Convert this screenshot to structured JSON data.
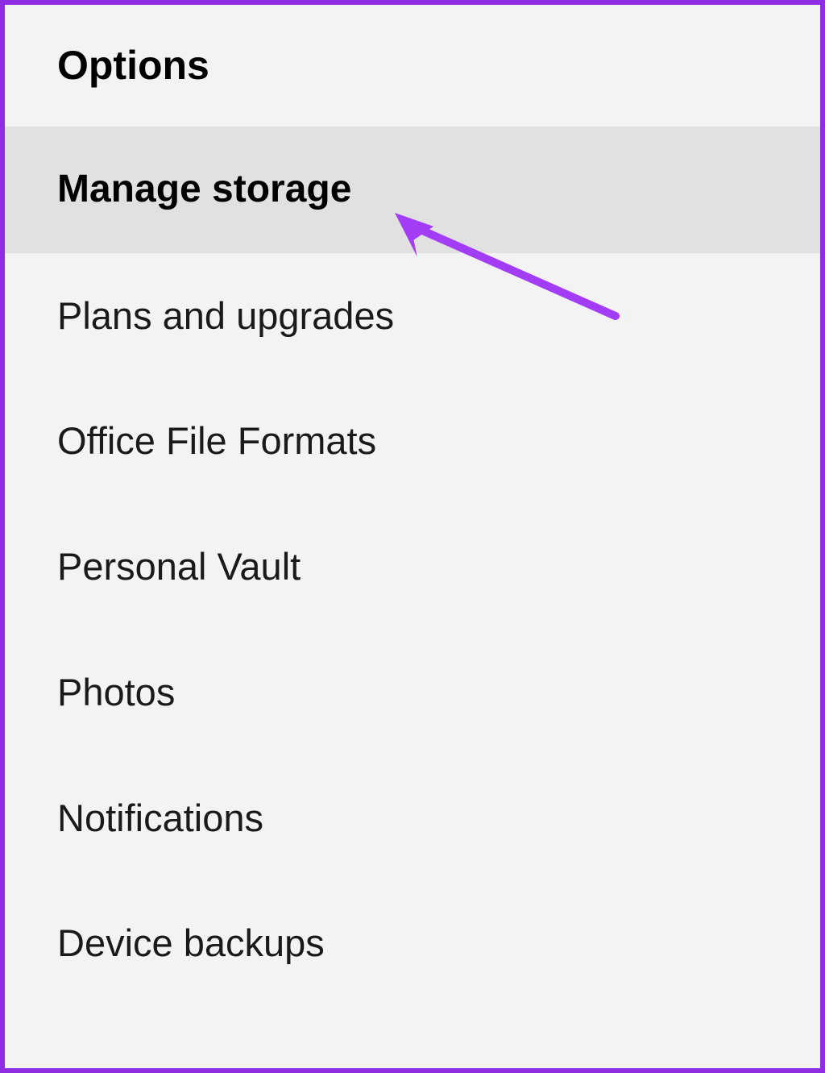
{
  "menu": {
    "header": "Options",
    "items": [
      {
        "label": "Manage storage",
        "selected": true
      },
      {
        "label": "Plans and upgrades",
        "selected": false
      },
      {
        "label": "Office File Formats",
        "selected": false
      },
      {
        "label": "Personal Vault",
        "selected": false
      },
      {
        "label": "Photos",
        "selected": false
      },
      {
        "label": "Notifications",
        "selected": false
      },
      {
        "label": "Device backups",
        "selected": false
      }
    ]
  },
  "annotation": {
    "arrow_color": "#a23df5"
  }
}
